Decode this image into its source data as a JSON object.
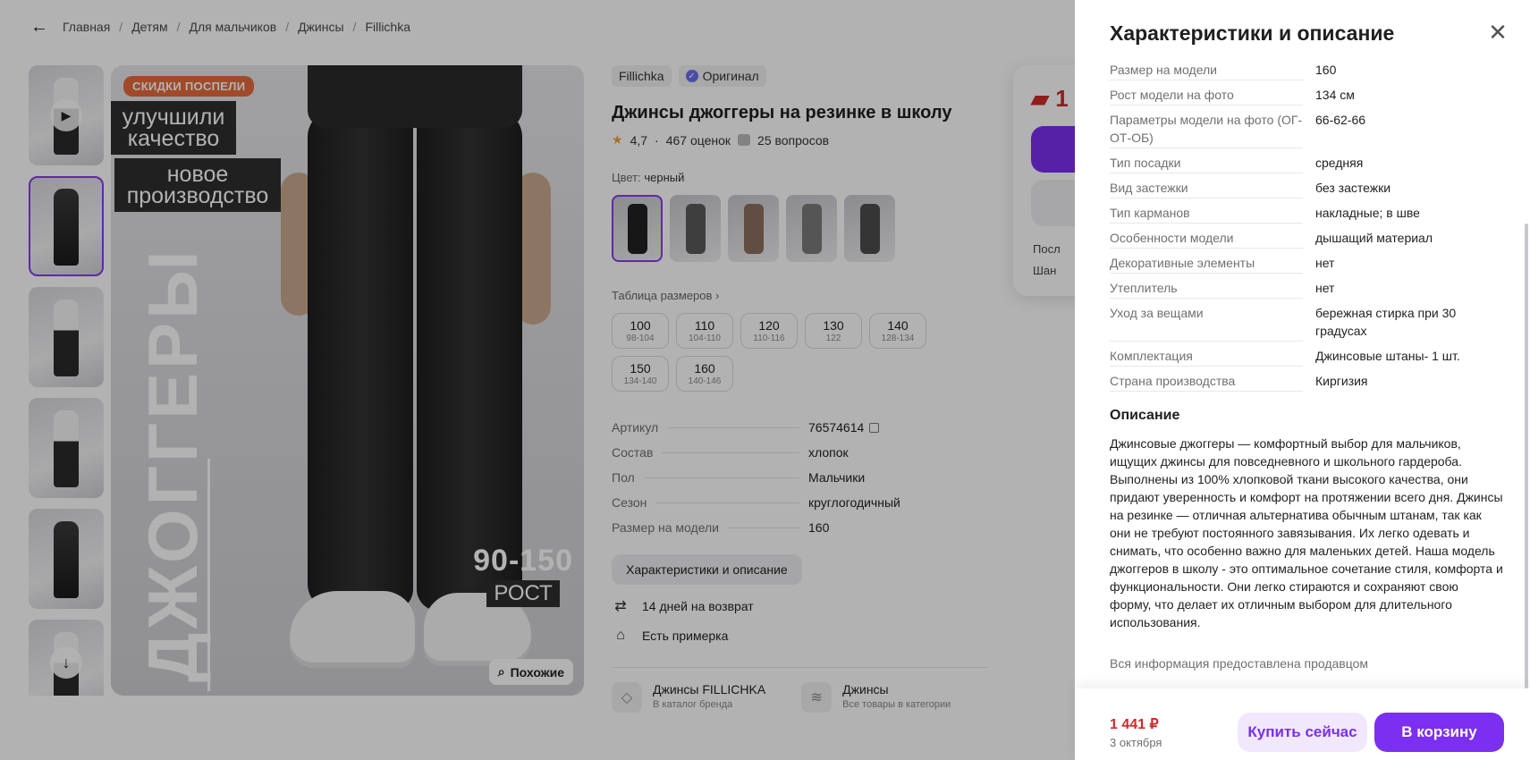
{
  "breadcrumbs": [
    "Главная",
    "Детям",
    "Для мальчиков",
    "Джинсы",
    "Fillichka"
  ],
  "gallery": {
    "promo_badge": "СКИДКИ ПОСПЕЛИ",
    "promo_line1": "улучшили качество",
    "promo_line2": "новое производство",
    "vertical_text": "ДЖОГГЕРЫ",
    "range_number": "90-150",
    "range_label": "РОСТ",
    "similar_label": "Похожие"
  },
  "product": {
    "brand_tag": "Fillichka",
    "original_tag": "Оригинал",
    "title": "Джинсы джоггеры на резинке в школу",
    "rating": "4,7",
    "reviews": "467 оценок",
    "questions": "25 вопросов",
    "color_label": "Цвет:",
    "color_value": "черный",
    "size_table_link": "Таблица размеров",
    "sizes": [
      {
        "size": "100",
        "range": "98-104"
      },
      {
        "size": "110",
        "range": "104-110"
      },
      {
        "size": "120",
        "range": "110-116"
      },
      {
        "size": "130",
        "range": "122"
      },
      {
        "size": "140",
        "range": "128-134"
      },
      {
        "size": "150",
        "range": "134-140"
      },
      {
        "size": "160",
        "range": "140-146"
      }
    ],
    "specs": [
      {
        "k": "Артикул",
        "v": "76574614"
      },
      {
        "k": "Состав",
        "v": "хлопок"
      },
      {
        "k": "Пол",
        "v": "Мальчики"
      },
      {
        "k": "Сезон",
        "v": "круглогодичный"
      },
      {
        "k": "Размер на модели",
        "v": "160"
      }
    ],
    "char_button": "Характеристики и описание",
    "perk_return": "14 дней на возврат",
    "perk_fitting": "Есть примерка",
    "brand_card_title": "Джинсы FILLICHKA",
    "brand_card_sub": "В каталог бренда",
    "cat_card_title": "Джинсы",
    "cat_card_sub": "Все товары в категории"
  },
  "buybox": {
    "price_partial": "1",
    "line1": "Посл",
    "line2": "Шан"
  },
  "drawer": {
    "title": "Характеристики и описание",
    "rows": [
      {
        "k": "Размер на модели",
        "v": "160"
      },
      {
        "k": "Рост модели на фото",
        "v": "134 см"
      },
      {
        "k": "Параметры модели на фото (ОГ-ОТ-ОБ)",
        "v": "66-62-66"
      },
      {
        "k": "Тип посадки",
        "v": "средняя"
      },
      {
        "k": "Вид застежки",
        "v": "без застежки"
      },
      {
        "k": "Тип карманов",
        "v": "накладные; в шве"
      },
      {
        "k": "Особенности модели",
        "v": "дышащий материал"
      },
      {
        "k": "Декоративные элементы",
        "v": "нет"
      },
      {
        "k": "Утеплитель",
        "v": "нет"
      },
      {
        "k": "Уход за вещами",
        "v": "бережная стирка при 30 градусах"
      },
      {
        "k": "Комплектация",
        "v": "Джинсовые штаны- 1 шт."
      },
      {
        "k": "Страна производства",
        "v": "Киргизия"
      }
    ],
    "desc_heading": "Описание",
    "description": "Джинсовые джоггеры — комфортный выбор для мальчиков, ищущих джинсы для повседневного и школьного гардероба. Выполнены из 100% хлопковой ткани высокого качества, они придают уверенность и комфорт на протяжении всего дня. Джинсы на резинке — отличная альтернатива обычным штанам, так как они не требуют постоянного завязывания. Их легко одевать и снимать, что особенно важно для маленьких детей. Наша модель джоггеров в школу - это оптимальное сочетание стиля, комфорта и функциональности. Они легко стираются и сохраняют свою форму, что делает их отличным выбором для длительного использования.",
    "seller_note": "Вся информация предоставлена продавцом",
    "footer_price": "1 441 ₽",
    "footer_date": "3 октября",
    "buy_now": "Купить сейчас",
    "add_to_cart": "В корзину"
  },
  "colors": {
    "accent": "#7b2ff0",
    "price_red": "#d02a2a",
    "promo_orange": "#e66a3d"
  }
}
